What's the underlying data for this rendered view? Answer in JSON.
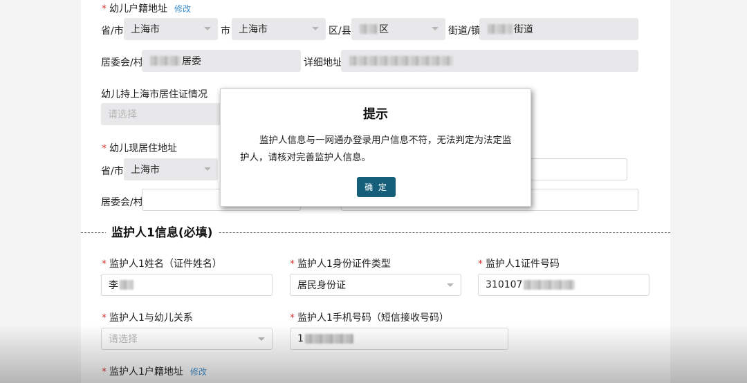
{
  "household": {
    "label": "幼儿户籍地址",
    "edit": "修改",
    "province_label": "省/市",
    "province_value": "上海市",
    "city_label": "市",
    "city_value": "上海市",
    "district_label": "区/县",
    "district_suffix": "区",
    "street_label": "街道/镇",
    "street_suffix": "街道",
    "committee_label": "居委会/村",
    "committee_suffix": "居委",
    "detail_label": "详细地址"
  },
  "residence_permit": {
    "label": "幼儿持上海市居住证情况",
    "placeholder": "请选择"
  },
  "current_address": {
    "label": "幼儿现居住地址",
    "province_label": "省/市",
    "province_value": "上海市",
    "committee_label": "居委会/村"
  },
  "guardian_section": {
    "title": "监护人1信息(必填)",
    "name_label": "监护人1姓名（证件姓名）",
    "name_value": "李",
    "id_type_label": "监护人1身份证件类型",
    "id_type_value": "居民身份证",
    "id_number_label": "监护人1证件号码",
    "id_number_value": "310107",
    "relation_label": "监护人1与幼儿关系",
    "relation_placeholder": "请选择",
    "phone_label": "监护人1手机号码（短信接收号码）",
    "phone_value": "1",
    "household_label": "监护人1户籍地址",
    "household_edit": "修改"
  },
  "dialog": {
    "title": "提示",
    "message": "监护人信息与一网通办登录用户信息不符，无法判定为法定监护人，请核对完善监护人信息。",
    "ok_label": "确 定"
  },
  "colors": {
    "required": "#d9322e",
    "link": "#3a8ed1",
    "ok_button": "#165f7a"
  }
}
